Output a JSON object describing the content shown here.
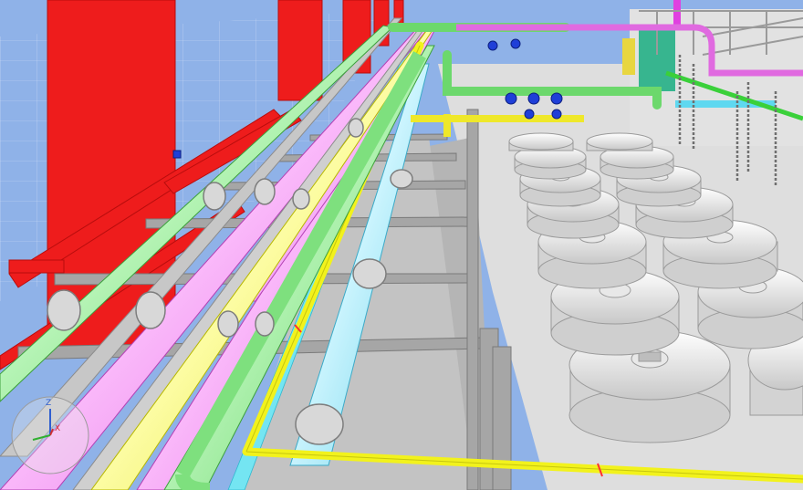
{
  "viewport": {
    "background_sky": "#8fb2e8",
    "floor_color": "#d9d9d9",
    "colors": {
      "structure_red": "#ee1c1c",
      "pipe_green": "#7ee07e",
      "pipe_magenta": "#f07cf0",
      "pipe_yellow": "#ffff3c",
      "pipe_cyan": "#7fe6f5",
      "pipe_light_blue": "#8fdcf5",
      "steel_gray": "#a8a8a8",
      "tank_white": "#eeeeee",
      "valve_blue": "#1f3fd8"
    }
  },
  "gizmo": {
    "axes": [
      {
        "name": "Z",
        "color": "#2f5fd0"
      },
      {
        "name": "X",
        "color": "#d03030"
      },
      {
        "name": "Y",
        "color": "#30b030"
      }
    ]
  }
}
